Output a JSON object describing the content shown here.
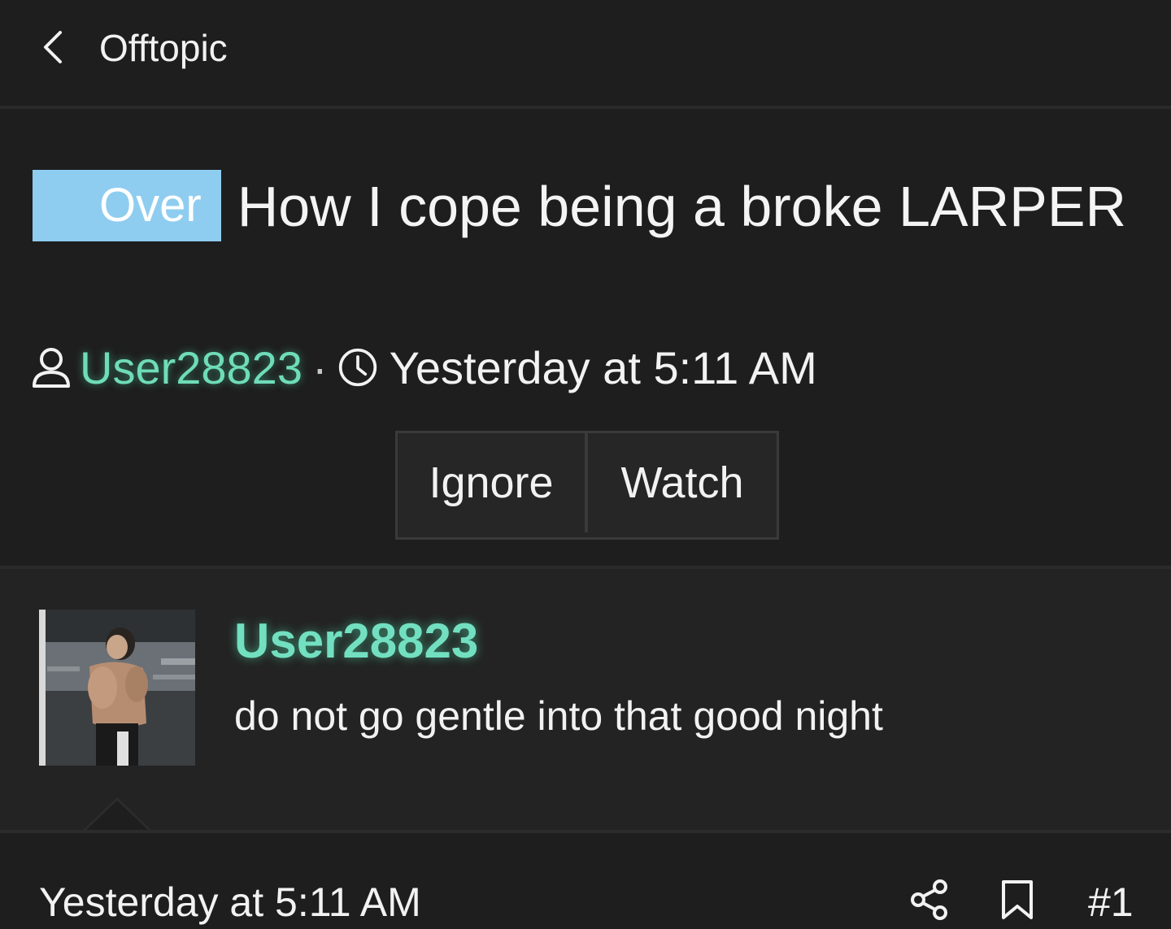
{
  "nav": {
    "title": "Offtopic"
  },
  "thread": {
    "prefix": "Over",
    "title": "How I cope being a broke LARPER",
    "author": "User28823",
    "separator": "·",
    "time": "Yesterday at 5:11 AM",
    "buttons": {
      "ignore": "Ignore",
      "watch": "Watch"
    }
  },
  "post": {
    "author": "User28823",
    "body": "do not go gentle into that good night",
    "time": "Yesterday at 5:11 AM",
    "number": "#1"
  },
  "colors": {
    "background": "#1e1e1e",
    "prefix_badge": "#8ecdf0",
    "username": "#6fdcb9"
  },
  "icons": [
    "chevron-left-icon",
    "user-icon",
    "clock-icon",
    "share-icon",
    "bookmark-icon"
  ]
}
